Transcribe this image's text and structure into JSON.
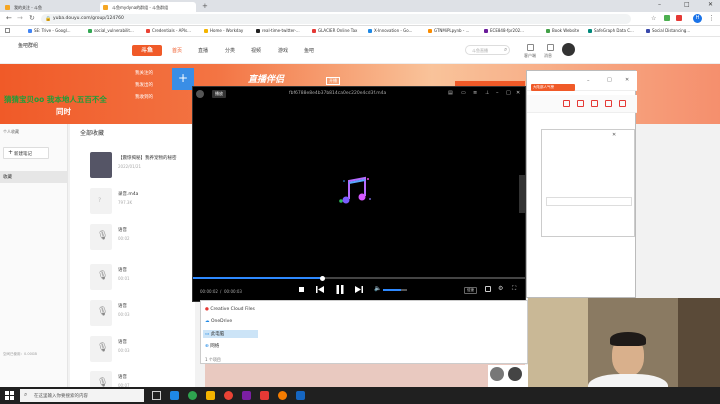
{
  "browser": {
    "tabs": [
      {
        "label": "我的关注 - 斗鱼",
        "active": false
      },
      {
        "label": "斗鱼mydyna的群组 - 斗鱼群组",
        "active": true
      }
    ],
    "url": "yuba.douyu.com/group/124760",
    "bookmarks": [
      "SE: Trive - Googl...",
      "social_vulnerabilit...",
      "Credentials - APIs...",
      "Home - Workday",
      "real-time-twitter-...",
      "GLACIER Online Tax",
      "X-Innovation - Go...",
      "GTNMiPLpynb - ...",
      "ECE848-fpr202...",
      "Book Website",
      "SafeGraph Data C...",
      "Social Distancing..."
    ],
    "avatar_letter": "H"
  },
  "site": {
    "logo_text": "斗鱼",
    "nav": [
      "首页",
      "直播",
      "分类",
      "视频",
      "游戏",
      "鱼吧"
    ],
    "search_placeholder": "斗鱼直播",
    "header_right": [
      "客户端",
      "消息"
    ],
    "banner_menu": [
      "我关注的",
      "我发出的",
      "我收到的"
    ],
    "banner_text": "猜猜宝贝oo 我本地人五百不全",
    "banner_text2": "同时",
    "banner_logo": "直播伴侣",
    "banner_badge": "开播",
    "left_section_label": "个人收藏",
    "new_note_button": "新建笔记",
    "left_items": [
      "收藏"
    ],
    "left_footer": "空间已使用：0.00GB",
    "main_title": "全部收藏",
    "items": [
      {
        "name": "【震惊揭秘】我养宠物的秘密",
        "size": "2022/01/21",
        "type": "video"
      },
      {
        "name": "录音.m4a",
        "size": "797.3K",
        "type": "file"
      },
      {
        "name": "语音",
        "size": "00:02",
        "type": "voice"
      },
      {
        "name": "语音",
        "size": "00:01",
        "type": "voice"
      },
      {
        "name": "语音",
        "size": "00:03",
        "type": "voice"
      },
      {
        "name": "语音",
        "size": "00:03",
        "type": "voice"
      },
      {
        "name": "语音",
        "size": "00:07",
        "type": "voice"
      }
    ]
  },
  "player": {
    "badge": "播放",
    "filename": "fbf6788e8e4b37b814ca0ec220e4cd3f.m4a",
    "time_current": "00:00:02",
    "time_total": "00:00:03",
    "progress": 0.39,
    "volume": 0.75,
    "speed_label": "倍速"
  },
  "explorer": {
    "items": [
      "Creative Cloud Files",
      "OneDrive",
      "此电脑",
      "网络"
    ],
    "selected": "此电脑",
    "status": "1 个项目"
  },
  "rightapp": {
    "tag": "大陆部人气榜"
  },
  "taskbar": {
    "search_placeholder": "在这里输入你要搜索的内容"
  },
  "colors": {
    "accent": "#f05a28",
    "player_progress": "#2e89ff"
  }
}
